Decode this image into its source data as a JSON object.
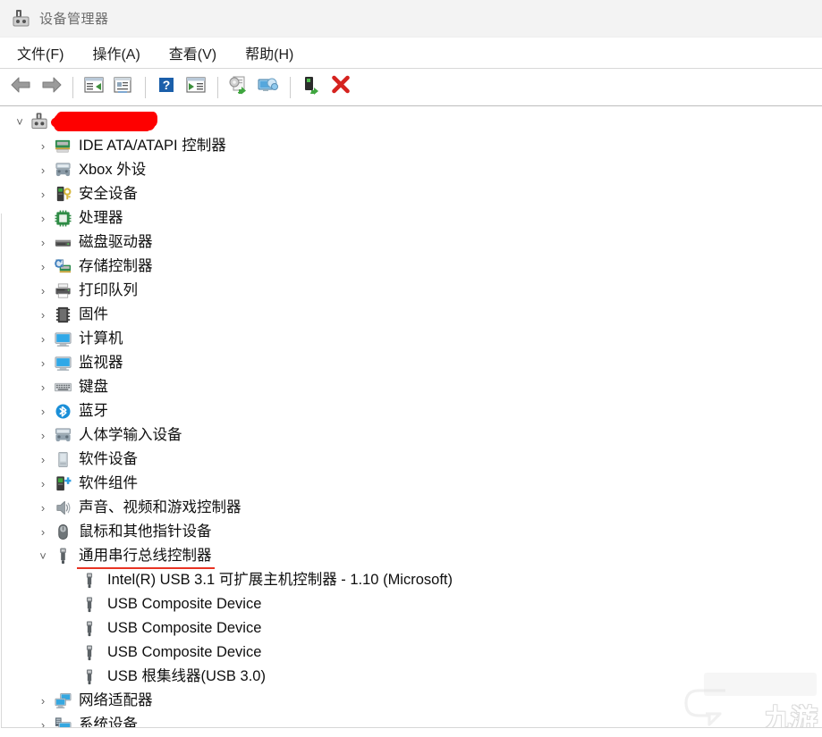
{
  "window": {
    "title": "设备管理器",
    "title_icon": "device-manager-icon"
  },
  "menubar": {
    "items": [
      {
        "label": "文件(F)",
        "name": "menu-file"
      },
      {
        "label": "操作(A)",
        "name": "menu-action"
      },
      {
        "label": "查看(V)",
        "name": "menu-view"
      },
      {
        "label": "帮助(H)",
        "name": "menu-help"
      }
    ]
  },
  "toolbar": {
    "buttons": [
      {
        "icon": "back-arrow-icon",
        "name": "toolbar-back"
      },
      {
        "icon": "forward-arrow-icon",
        "name": "toolbar-forward"
      },
      {
        "sep": true
      },
      {
        "icon": "show-hide-console-tree-icon",
        "name": "toolbar-console-tree"
      },
      {
        "icon": "properties-icon",
        "name": "toolbar-properties"
      },
      {
        "sep": true
      },
      {
        "icon": "help-icon",
        "name": "toolbar-help"
      },
      {
        "icon": "show-hide-action-pane-icon",
        "name": "toolbar-action-pane"
      },
      {
        "sep": true
      },
      {
        "icon": "update-driver-icon",
        "name": "toolbar-update-driver"
      },
      {
        "icon": "scan-hardware-changes-icon",
        "name": "toolbar-scan-hardware"
      },
      {
        "sep": true
      },
      {
        "icon": "enable-device-icon",
        "name": "toolbar-enable-device"
      },
      {
        "icon": "uninstall-device-icon",
        "name": "toolbar-uninstall-device"
      }
    ]
  },
  "tree": {
    "root": {
      "label": "",
      "redacted": true,
      "expanded": true,
      "icon": "computer-root-icon"
    },
    "nodes": [
      {
        "label": "IDE ATA/ATAPI 控制器",
        "icon": "ide-controller-icon",
        "expanded": false
      },
      {
        "label": "Xbox 外设",
        "icon": "xbox-peripheral-icon",
        "expanded": false
      },
      {
        "label": "安全设备",
        "icon": "security-device-icon",
        "expanded": false
      },
      {
        "label": "处理器",
        "icon": "processor-icon",
        "expanded": false
      },
      {
        "label": "磁盘驱动器",
        "icon": "disk-drive-icon",
        "expanded": false
      },
      {
        "label": "存储控制器",
        "icon": "storage-controller-icon",
        "expanded": false
      },
      {
        "label": "打印队列",
        "icon": "print-queue-icon",
        "expanded": false
      },
      {
        "label": "固件",
        "icon": "firmware-icon",
        "expanded": false
      },
      {
        "label": "计算机",
        "icon": "computer-icon",
        "expanded": false
      },
      {
        "label": "监视器",
        "icon": "monitor-icon",
        "expanded": false
      },
      {
        "label": "键盘",
        "icon": "keyboard-icon",
        "expanded": false
      },
      {
        "label": "蓝牙",
        "icon": "bluetooth-icon",
        "expanded": false
      },
      {
        "label": "人体学输入设备",
        "icon": "hid-device-icon",
        "expanded": false
      },
      {
        "label": "软件设备",
        "icon": "software-device-icon",
        "expanded": false
      },
      {
        "label": "软件组件",
        "icon": "software-component-icon",
        "expanded": false
      },
      {
        "label": "声音、视频和游戏控制器",
        "icon": "sound-video-game-controller-icon",
        "expanded": false
      },
      {
        "label": "鼠标和其他指针设备",
        "icon": "mouse-icon",
        "expanded": false
      },
      {
        "label": "通用串行总线控制器",
        "icon": "usb-controller-icon",
        "expanded": true,
        "annotated": true,
        "children": [
          {
            "label": "Intel(R) USB 3.1 可扩展主机控制器 - 1.10 (Microsoft)",
            "icon": "usb-device-icon"
          },
          {
            "label": "USB Composite Device",
            "icon": "usb-device-icon"
          },
          {
            "label": "USB Composite Device",
            "icon": "usb-device-icon"
          },
          {
            "label": "USB Composite Device",
            "icon": "usb-device-icon"
          },
          {
            "label": "USB 根集线器(USB 3.0)",
            "icon": "usb-device-icon"
          }
        ]
      },
      {
        "label": "网络适配器",
        "icon": "network-adapter-icon",
        "expanded": false
      },
      {
        "label": "系统设备",
        "icon": "system-device-icon",
        "expanded": false
      }
    ],
    "chevron_collapsed": "›",
    "chevron_expanded": "˅"
  },
  "watermark": {
    "text": "九游"
  },
  "colors": {
    "redaction_red": "#fe0000",
    "underline_red": "#e83323",
    "titlebar_bg": "#f3f3f3",
    "text": "#0f0f0f"
  }
}
